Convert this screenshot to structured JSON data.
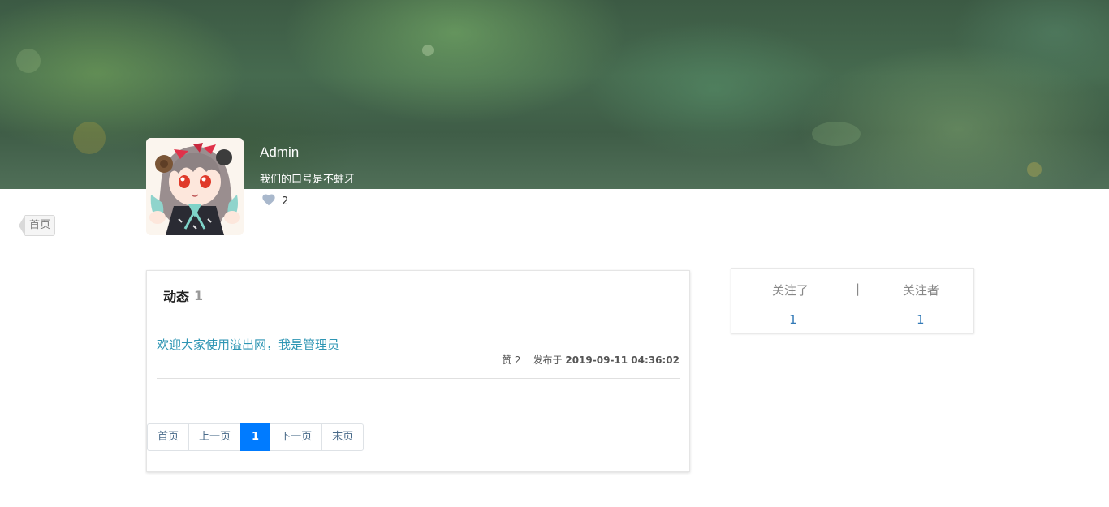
{
  "profile": {
    "username": "Admin",
    "motto": "我们的口号是不蛀牙",
    "likes_count": "2"
  },
  "nav": {
    "home_label": "首页"
  },
  "feed": {
    "title": "动态",
    "count": "1",
    "posts": [
      {
        "title": "欢迎大家使用溢出网，我是管理员",
        "likes": "赞 2",
        "published_prefix": "发布于",
        "published_at": "2019-09-11 04:36:02"
      }
    ]
  },
  "pagination": {
    "first": "首页",
    "prev": "上一页",
    "current": "1",
    "next": "下一页",
    "last": "末页"
  },
  "follow": {
    "following_label": "关注了",
    "separator": "|",
    "followers_label": "关注者",
    "following_count": "1",
    "followers_count": "1"
  },
  "colors": {
    "accent": "#007bff",
    "post_link": "#2f96b4",
    "count_link": "#337ab7",
    "heart": "#a9b8cc"
  }
}
